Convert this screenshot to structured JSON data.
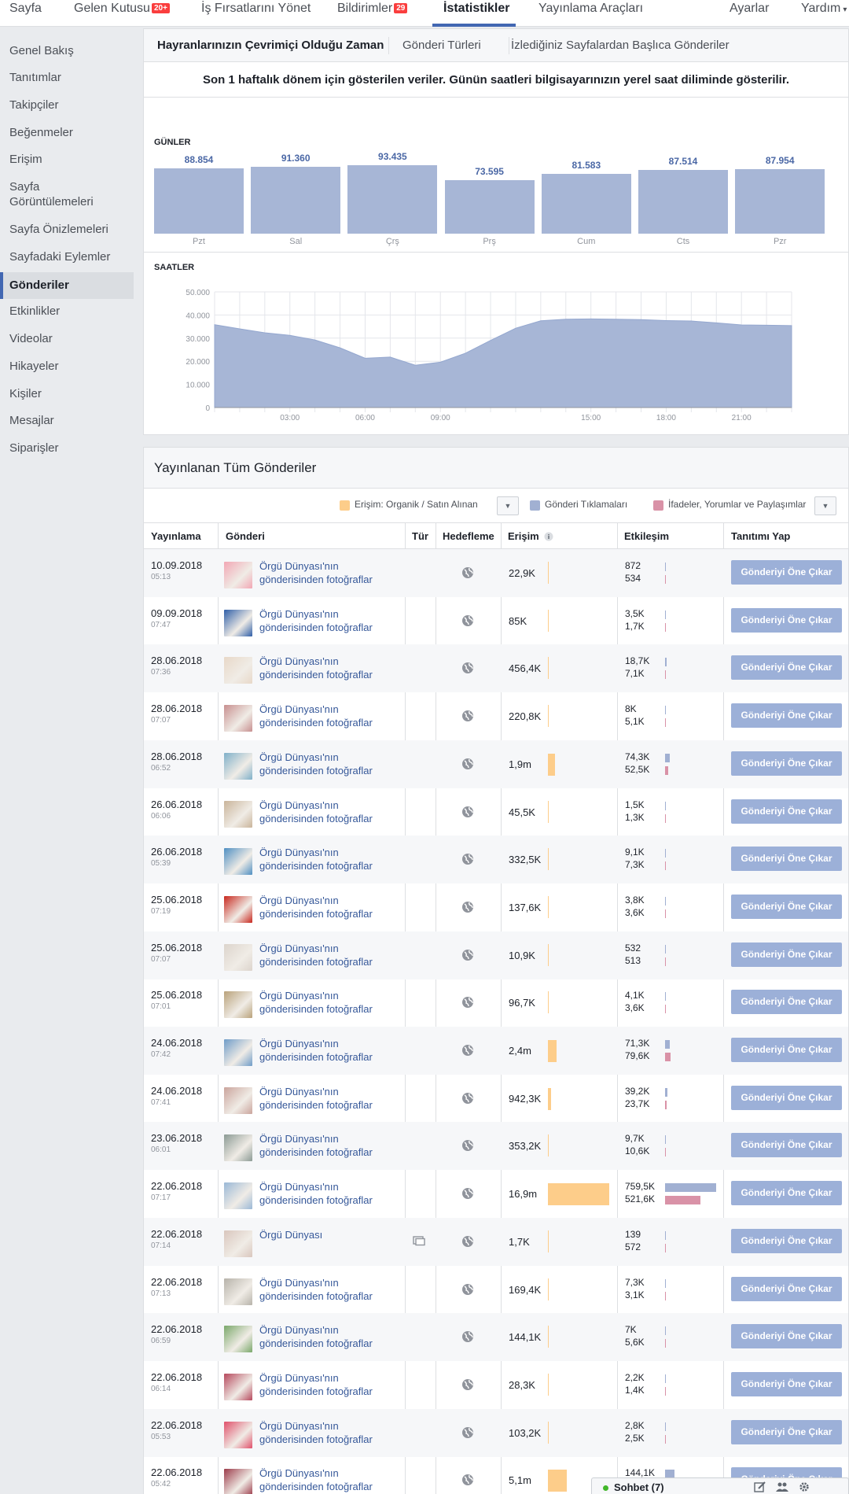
{
  "topnav": {
    "items": [
      {
        "label": "Sayfa"
      },
      {
        "label": "Gelen Kutusu",
        "badge": "20+"
      },
      {
        "label": "İş Fırsatlarını Yönet"
      },
      {
        "label": "Bildirimler",
        "badge": "29"
      },
      {
        "label": "İstatistikler",
        "active": true
      },
      {
        "label": "Yayınlama Araçları"
      },
      {
        "label": "Ayarlar"
      },
      {
        "label": "Yardım",
        "caret": "▾"
      }
    ]
  },
  "sidebar": {
    "items": [
      {
        "label": "Genel Bakış"
      },
      {
        "label": "Tanıtımlar"
      },
      {
        "label": "Takipçiler"
      },
      {
        "label": "Beğenmeler"
      },
      {
        "label": "Erişim"
      },
      {
        "label": "Sayfa\nGörüntülemeleri"
      },
      {
        "label": "Sayfa Önizlemeleri"
      },
      {
        "label": "Sayfadaki Eylemler"
      },
      {
        "label": "Gönderiler",
        "active": true
      },
      {
        "label": "Etkinlikler"
      },
      {
        "label": "Videolar"
      },
      {
        "label": "Hikayeler"
      },
      {
        "label": "Kişiler"
      },
      {
        "label": "Mesajlar"
      },
      {
        "label": "Siparişler"
      }
    ]
  },
  "insights_tabs": [
    {
      "label": "Hayranlarınızın Çevrimiçi Olduğu Zaman",
      "active": true
    },
    {
      "label": "Gönderi Türleri"
    },
    {
      "label": "İzlediğiniz Sayfalardan Başlıca Gönderiler"
    }
  ],
  "notice": "Son 1 haftalık dönem için gösterilen veriler. Günün saatleri bilgisayarınızın yerel saat diliminde gösterilir.",
  "days_label": "GÜNLER",
  "hours_label": "SAATLER",
  "chart_data": [
    {
      "type": "bar",
      "title": "GÜNLER",
      "categories": [
        "Pzt",
        "Sal",
        "Çrş",
        "Prş",
        "Cum",
        "Cts",
        "Pzr"
      ],
      "value_labels": [
        "88.854",
        "91.360",
        "93.435",
        "73.595",
        "81.583",
        "87.514",
        "87.954"
      ],
      "values": [
        88854,
        91360,
        93435,
        73595,
        81583,
        87514,
        87954
      ],
      "color": "#a7b6d6"
    },
    {
      "type": "area",
      "title": "SAATLER",
      "x_tick_labels": [
        "03:00",
        "06:00",
        "09:00",
        "15:00",
        "18:00",
        "21:00"
      ],
      "y_tick_labels": [
        "50.000",
        "40.000",
        "30.000",
        "20.000",
        "10.000",
        "0"
      ],
      "ylim": [
        0,
        50000
      ],
      "grid": true,
      "color": "#a7b6d6",
      "x": [
        0,
        1,
        2,
        3,
        4,
        5,
        6,
        7,
        8,
        9,
        10,
        11,
        12,
        13,
        14,
        15,
        16,
        17,
        18,
        19,
        20,
        21,
        22,
        23
      ],
      "y": [
        35800,
        34000,
        32300,
        31200,
        29200,
        25800,
        21300,
        21800,
        18300,
        19600,
        23500,
        29000,
        34300,
        37500,
        38200,
        38300,
        38200,
        38000,
        37600,
        37400,
        36600,
        35700,
        35600,
        35400
      ]
    }
  ],
  "posts_section": {
    "title": "Yayınlanan Tüm Gönderiler",
    "legend": [
      {
        "label": "Erişim: Organik / Satın Alınan",
        "color": "#fdcd8a"
      },
      {
        "label": "Gönderi Tıklamaları",
        "color": "#a1b0d2"
      },
      {
        "label": "İfadeler, Yorumlar ve Paylaşımlar",
        "color": "#d992a7"
      }
    ],
    "columns": [
      "Yayınlama",
      "Gönderi",
      "Tür",
      "Hedefleme",
      "Erişim",
      "Etkileşim",
      "Tanıtımı Yap"
    ],
    "promote_label": "Gönderiyi Öne Çıkar",
    "post_link_default": "Örgü Dünyası'nın gönderisinden fotoğraflar",
    "rows": [
      {
        "date": "10.09.2018",
        "time": "05:13",
        "post": "Örgü Dünyası'nın gönderisinden fotoğraflar",
        "reach": "22,9K",
        "reach_num": 22900,
        "eng1": "872",
        "eng1_num": 872,
        "eng2": "534",
        "eng2_num": 534,
        "thumb": "#f2a7b4"
      },
      {
        "date": "09.09.2018",
        "time": "07:47",
        "post": "Örgü Dünyası'nın gönderisinden fotoğraflar",
        "reach": "85K",
        "reach_num": 85000,
        "eng1": "3,5K",
        "eng1_num": 3500,
        "eng2": "1,7K",
        "eng2_num": 1700,
        "thumb": "#2f5fa8"
      },
      {
        "date": "28.06.2018",
        "time": "07:36",
        "post": "Örgü Dünyası'nın gönderisinden fotoğraflar",
        "reach": "456,4K",
        "reach_num": 456400,
        "eng1": "18,7K",
        "eng1_num": 18700,
        "eng2": "7,1K",
        "eng2_num": 7100,
        "thumb": "#e8d8c8"
      },
      {
        "date": "28.06.2018",
        "time": "07:07",
        "post": "Örgü Dünyası'nın gönderisinden fotoğraflar",
        "reach": "220,8K",
        "reach_num": 220800,
        "eng1": "8K",
        "eng1_num": 8000,
        "eng2": "5,1K",
        "eng2_num": 5100,
        "thumb": "#c78f8f"
      },
      {
        "date": "28.06.2018",
        "time": "06:52",
        "post": "Örgü Dünyası'nın gönderisinden fotoğraflar",
        "reach": "1,9m",
        "reach_num": 1900000,
        "eng1": "74,3K",
        "eng1_num": 74300,
        "eng2": "52,5K",
        "eng2_num": 52500,
        "thumb": "#7fb0c9"
      },
      {
        "date": "26.06.2018",
        "time": "06:06",
        "post": "Örgü Dünyası'nın gönderisinden fotoğraflar",
        "reach": "45,5K",
        "reach_num": 45500,
        "eng1": "1,5K",
        "eng1_num": 1500,
        "eng2": "1,3K",
        "eng2_num": 1300,
        "thumb": "#c9b49a"
      },
      {
        "date": "26.06.2018",
        "time": "05:39",
        "post": "Örgü Dünyası'nın gönderisinden fotoğraflar",
        "reach": "332,5K",
        "reach_num": 332500,
        "eng1": "9,1K",
        "eng1_num": 9100,
        "eng2": "7,3K",
        "eng2_num": 7300,
        "thumb": "#4f8fc2"
      },
      {
        "date": "25.06.2018",
        "time": "07:19",
        "post": "Örgü Dünyası'nın gönderisinden fotoğraflar",
        "reach": "137,6K",
        "reach_num": 137600,
        "eng1": "3,8K",
        "eng1_num": 3800,
        "eng2": "3,6K",
        "eng2_num": 3600,
        "thumb": "#c8281e"
      },
      {
        "date": "25.06.2018",
        "time": "07:07",
        "post": "Örgü Dünyası'nın gönderisinden fotoğraflar",
        "reach": "10,9K",
        "reach_num": 10900,
        "eng1": "532",
        "eng1_num": 532,
        "eng2": "513",
        "eng2_num": 513,
        "thumb": "#dcd4cc"
      },
      {
        "date": "25.06.2018",
        "time": "07:01",
        "post": "Örgü Dünyası'nın gönderisinden fotoğraflar",
        "reach": "96,7K",
        "reach_num": 96700,
        "eng1": "4,1K",
        "eng1_num": 4100,
        "eng2": "3,6K",
        "eng2_num": 3600,
        "thumb": "#b9a27a"
      },
      {
        "date": "24.06.2018",
        "time": "07:42",
        "post": "Örgü Dünyası'nın gönderisinden fotoğraflar",
        "reach": "2,4m",
        "reach_num": 2400000,
        "eng1": "71,3K",
        "eng1_num": 71300,
        "eng2": "79,6K",
        "eng2_num": 79600,
        "thumb": "#6f9cc8"
      },
      {
        "date": "24.06.2018",
        "time": "07:41",
        "post": "Örgü Dünyası'nın gönderisinden fotoğraflar",
        "reach": "942,3K",
        "reach_num": 942300,
        "eng1": "39,2K",
        "eng1_num": 39200,
        "eng2": "23,7K",
        "eng2_num": 23700,
        "thumb": "#caa49c"
      },
      {
        "date": "23.06.2018",
        "time": "06:01",
        "post": "Örgü Dünyası'nın gönderisinden fotoğraflar",
        "reach": "353,2K",
        "reach_num": 353200,
        "eng1": "9,7K",
        "eng1_num": 9700,
        "eng2": "10,6K",
        "eng2_num": 10600,
        "thumb": "#8b9a94"
      },
      {
        "date": "22.06.2018",
        "time": "07:17",
        "post": "Örgü Dünyası'nın gönderisinden fotoğraflar",
        "reach": "16,9m",
        "reach_num": 16900000,
        "eng1": "759,5K",
        "eng1_num": 759500,
        "eng2": "521,6K",
        "eng2_num": 521600,
        "thumb": "#9ab8d6"
      },
      {
        "date": "22.06.2018",
        "time": "07:14",
        "post": "Örgü Dünyası",
        "type_icon": true,
        "reach": "1,7K",
        "reach_num": 1700,
        "eng1": "139",
        "eng1_num": 139,
        "eng2": "572",
        "eng2_num": 572,
        "thumb": "#d9c6bd"
      },
      {
        "date": "22.06.2018",
        "time": "07:13",
        "post": "Örgü Dünyası'nın gönderisinden fotoğraflar",
        "reach": "169,4K",
        "reach_num": 169400,
        "eng1": "7,3K",
        "eng1_num": 7300,
        "eng2": "3,1K",
        "eng2_num": 3100,
        "thumb": "#b7b3aa"
      },
      {
        "date": "22.06.2018",
        "time": "06:59",
        "post": "Örgü Dünyası'nın gönderisinden fotoğraflar",
        "reach": "144,1K",
        "reach_num": 144100,
        "eng1": "7K",
        "eng1_num": 7000,
        "eng2": "5,6K",
        "eng2_num": 5600,
        "thumb": "#7aa86a"
      },
      {
        "date": "22.06.2018",
        "time": "06:14",
        "post": "Örgü Dünyası'nın gönderisinden fotoğraflar",
        "reach": "28,3K",
        "reach_num": 28300,
        "eng1": "2,2K",
        "eng1_num": 2200,
        "eng2": "1,4K",
        "eng2_num": 1400,
        "thumb": "#b6485c"
      },
      {
        "date": "22.06.2018",
        "time": "05:53",
        "post": "Örgü Dünyası'nın gönderisinden fotoğraflar",
        "reach": "103,2K",
        "reach_num": 103200,
        "eng1": "2,8K",
        "eng1_num": 2800,
        "eng2": "2,5K",
        "eng2_num": 2500,
        "thumb": "#e0506a"
      },
      {
        "date": "22.06.2018",
        "time": "05:42",
        "post": "Örgü Dünyası'nın gönderisinden fotoğraflar",
        "reach": "5,1m",
        "reach_num": 5100000,
        "eng1": "144,1K",
        "eng1_num": 144100,
        "eng2": "",
        "eng2_num": 0,
        "thumb": "#9c3b4a"
      }
    ]
  },
  "chat": {
    "label": "Sohbet (7)",
    "status_color": "#42b72a"
  }
}
